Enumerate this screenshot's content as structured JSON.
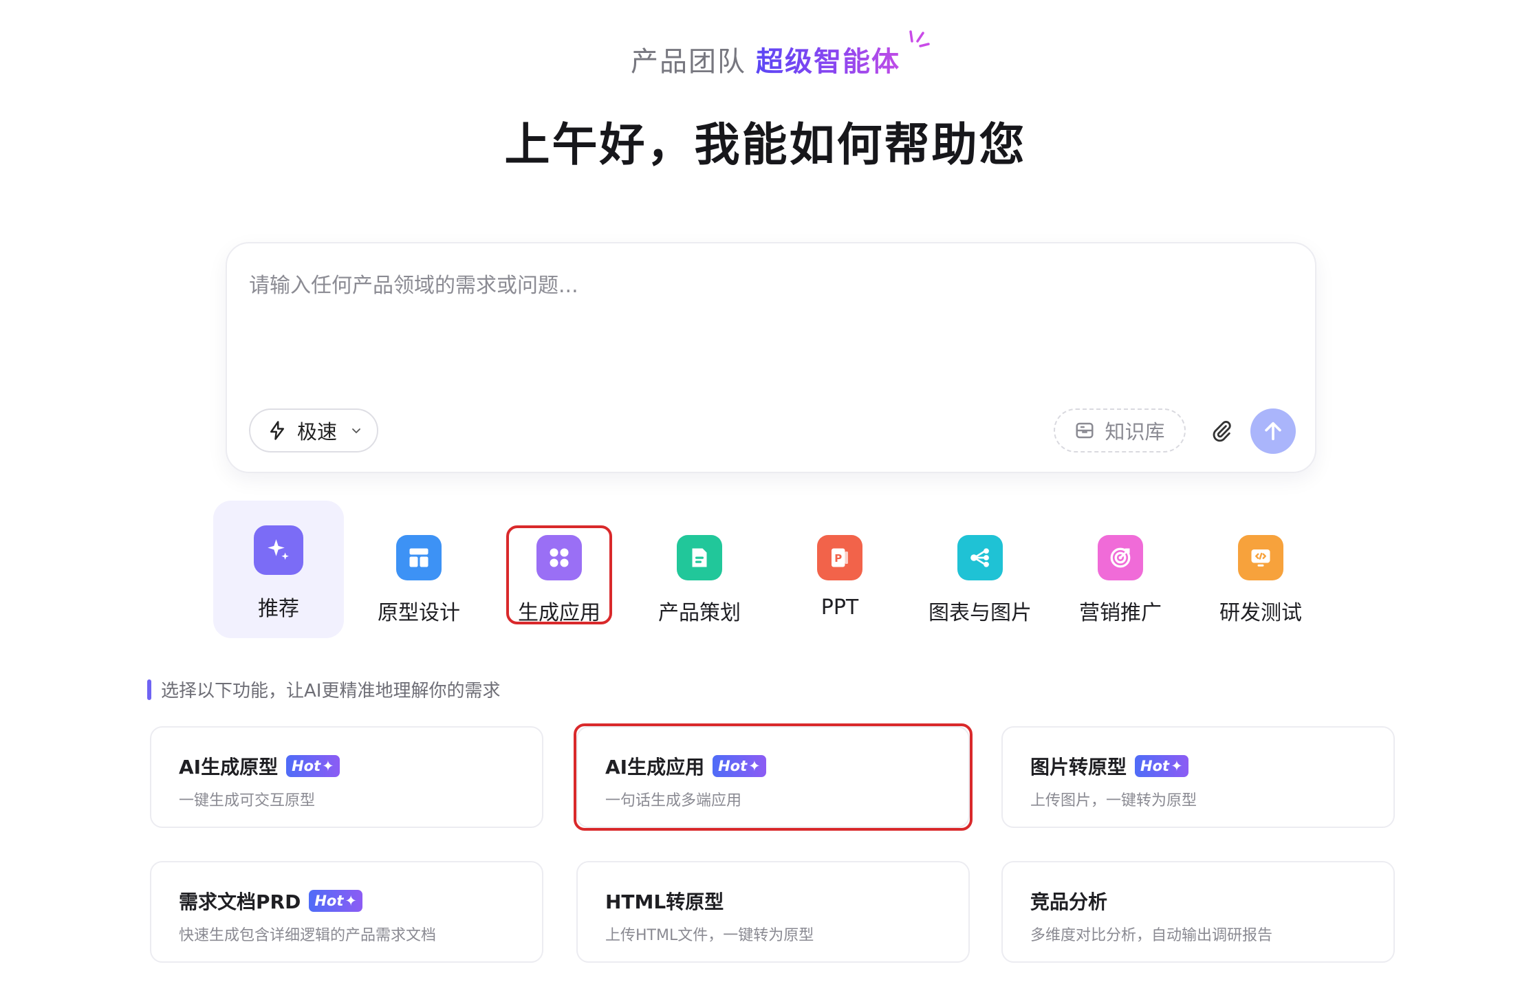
{
  "header": {
    "brand_team": "产品团队",
    "brand_agent": "超级智能体",
    "greeting": "上午好，我能如何帮助您"
  },
  "composer": {
    "placeholder": "请输入任何产品领域的需求或问题...",
    "mode_label": "极速",
    "knowledge_label": "知识库"
  },
  "categories": [
    {
      "label": "推荐",
      "color": "#7b6cf6"
    },
    {
      "label": "原型设计",
      "color": "#3d92f5"
    },
    {
      "label": "生成应用",
      "color": "#9a6ff5"
    },
    {
      "label": "产品策划",
      "color": "#21c79a"
    },
    {
      "label": "PPT",
      "color": "#f2634a"
    },
    {
      "label": "图表与图片",
      "color": "#1fc2d5"
    },
    {
      "label": "营销推广",
      "color": "#f06bd8"
    },
    {
      "label": "研发测试",
      "color": "#f7a23c"
    }
  ],
  "hint": "选择以下功能，让AI更精准地理解你的需求",
  "features": [
    {
      "title": "AI生成原型",
      "hot": "Hot",
      "desc": "一键生成可交互原型"
    },
    {
      "title": "AI生成应用",
      "hot": "Hot",
      "desc": "一句话生成多端应用"
    },
    {
      "title": "图片转原型",
      "hot": "Hot",
      "desc": "上传图片，一键转为原型"
    },
    {
      "title": "需求文档PRD",
      "hot": "Hot",
      "desc": "快速生成包含详细逻辑的产品需求文档"
    },
    {
      "title": "HTML转原型",
      "desc": "上传HTML文件，一键转为原型"
    },
    {
      "title": "竞品分析",
      "desc": "多维度对比分析，自动输出调研报告"
    }
  ]
}
